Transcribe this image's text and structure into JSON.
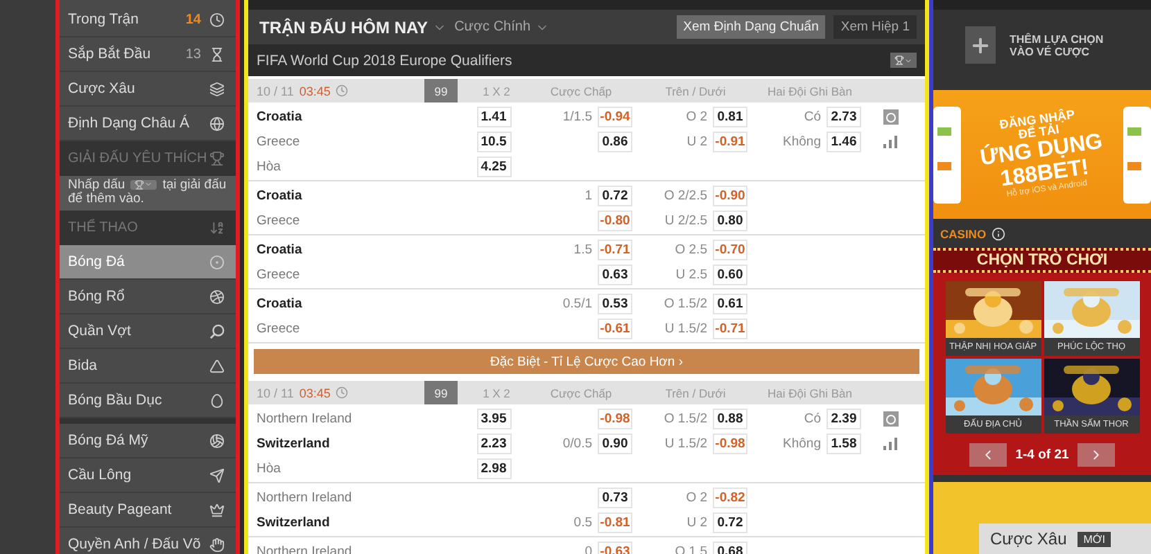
{
  "sidebar": {
    "menu": [
      {
        "label": "Trong Trận",
        "count": "14",
        "live": true,
        "selected": false
      },
      {
        "label": "Sắp Bắt Đầu",
        "count": "13",
        "live": false,
        "selected": false
      },
      {
        "label": "Cược Xâu",
        "selected": false
      },
      {
        "label": "Định Dạng Châu Á",
        "selected": false
      }
    ],
    "favorites": {
      "title": "GIẢI ĐẤU YÊU THÍCH",
      "note_before": "Nhấp dấu",
      "note_after": "tại giải đấu để thêm vào."
    },
    "sports_header": "THỂ THAO",
    "sports": [
      {
        "label": "Bóng Đá",
        "selected": true
      },
      {
        "label": "Bóng Rổ",
        "selected": false
      },
      {
        "label": "Quần Vợt",
        "selected": false
      },
      {
        "label": "Bida",
        "selected": false
      },
      {
        "label": "Bóng Bầu Dục",
        "selected": false
      }
    ],
    "more_sports": [
      {
        "label": "Bóng Đá Mỹ",
        "selected": false
      },
      {
        "label": "Cầu Lông",
        "selected": false
      },
      {
        "label": "Beauty Pageant",
        "selected": false
      },
      {
        "label": "Quyền Anh / Đấu Võ",
        "selected": false
      }
    ]
  },
  "main": {
    "title": "TRẬN ĐẤU HÔM NAY",
    "market": "Cược Chính",
    "views": [
      {
        "label": "Xem Định Dạng Chuẩn",
        "selected": true
      },
      {
        "label": "Xem Hiệp 1",
        "selected": false
      }
    ],
    "league": "FIFA World Cup 2018 Europe Qualifiers",
    "special": "Đặc Biệt - Tỉ Lệ Cược Cao Hơn ›",
    "matches": [
      {
        "date": "10 / 11",
        "time": "03:45",
        "count": "99",
        "columns": [
          "1 X 2",
          "Cược Chấp",
          "Trên / Dưới",
          "Hai Đội Ghi Bàn"
        ],
        "groups": [
          [
            {
              "team": "Croatia",
              "favorite": true,
              "x12": "1.41",
              "hcap_line": "1/1.5",
              "hcap": "-0.94",
              "ou_line": "O 2",
              "ou": "0.81",
              "btts_label": "Có",
              "btts": "2.73"
            },
            {
              "team": "Greece",
              "favorite": false,
              "x12": "10.5",
              "hcap": "0.86",
              "ou_line": "U 2",
              "ou": "-0.91",
              "btts_label": "Không",
              "btts": "1.46"
            },
            {
              "team": "Hòa",
              "favorite": false,
              "x12": "4.25"
            }
          ],
          [
            {
              "team": "Croatia",
              "favorite": true,
              "hcap_line": "1",
              "hcap": "0.72",
              "ou_line": "O 2/2.5",
              "ou": "-0.90"
            },
            {
              "team": "Greece",
              "favorite": false,
              "hcap": "-0.80",
              "ou_line": "U 2/2.5",
              "ou": "0.80"
            }
          ],
          [
            {
              "team": "Croatia",
              "favorite": true,
              "hcap_line": "1.5",
              "hcap": "-0.71",
              "ou_line": "O 2.5",
              "ou": "-0.70"
            },
            {
              "team": "Greece",
              "favorite": false,
              "hcap": "0.63",
              "ou_line": "U 2.5",
              "ou": "0.60"
            }
          ],
          [
            {
              "team": "Croatia",
              "favorite": true,
              "hcap_line": "0.5/1",
              "hcap": "0.53",
              "ou_line": "O 1.5/2",
              "ou": "0.61"
            },
            {
              "team": "Greece",
              "favorite": false,
              "hcap": "-0.61",
              "ou_line": "U 1.5/2",
              "ou": "-0.71"
            }
          ]
        ]
      },
      {
        "date": "10 / 11",
        "time": "03:45",
        "count": "99",
        "columns": [
          "1 X 2",
          "Cược Chấp",
          "Trên / Dưới",
          "Hai Đội Ghi Bàn"
        ],
        "groups": [
          [
            {
              "team": "Northern Ireland",
              "favorite": false,
              "x12": "3.95",
              "hcap": "-0.98",
              "ou_line": "O 1.5/2",
              "ou": "0.88",
              "btts_label": "Có",
              "btts": "2.39"
            },
            {
              "team": "Switzerland",
              "favorite": true,
              "x12": "2.23",
              "hcap_line": "0/0.5",
              "hcap": "0.90",
              "ou_line": "U 1.5/2",
              "ou": "-0.98",
              "btts_label": "Không",
              "btts": "1.58"
            },
            {
              "team": "Hòa",
              "favorite": false,
              "x12": "2.98"
            }
          ],
          [
            {
              "team": "Northern Ireland",
              "favorite": false,
              "hcap": "0.73",
              "ou_line": "O 2",
              "ou": "-0.82"
            },
            {
              "team": "Switzerland",
              "favorite": true,
              "hcap_line": "0.5",
              "hcap": "-0.81",
              "ou_line": "U 2",
              "ou": "0.72"
            }
          ],
          [
            {
              "team": "Northern Ireland",
              "favorite": false,
              "hcap_line": "0",
              "hcap": "-0.63",
              "ou_line": "O 1.5",
              "ou": "0.68"
            }
          ]
        ]
      }
    ]
  },
  "right": {
    "betslip_hint": "THÊM LỰA CHỌN VÀO VÉ CƯỢC",
    "banner": {
      "lines": [
        "ĐĂNG NHẬP",
        "ĐỂ TẢI",
        "ỨNG DỤNG",
        "188BET!"
      ],
      "footnote": "Hỗ trợ iOS và Android"
    },
    "casino": {
      "title": "CASINO",
      "heading": "CHỌN TRÒ CHƠI",
      "games": [
        {
          "name": "THẬP NHỊ HOA GIÁP",
          "kind": "picture"
        },
        {
          "name": "PHÚC LỘC THỌ",
          "kind": "picture"
        },
        {
          "name": "ĐẤU ĐỊA CHỦ",
          "kind": "picture"
        },
        {
          "name": "THẦN SẤM THOR",
          "kind": "picture"
        }
      ],
      "pager": "1-4 of 21"
    },
    "promo": {
      "title": "Cược Xâu",
      "badge": "MỚI"
    }
  }
}
